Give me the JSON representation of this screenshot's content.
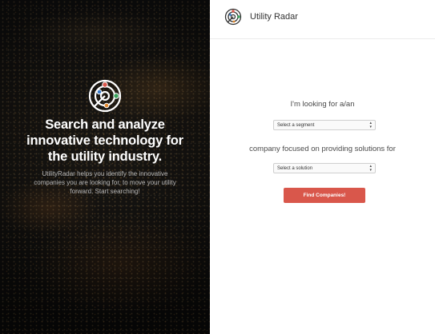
{
  "brand": {
    "name": "Utility Radar",
    "logo_icon": "radar-icon",
    "colors": {
      "red": "#d9574b",
      "green": "#3aa35c",
      "blue": "#3a7bc8",
      "orange": "#e38a2f"
    }
  },
  "hero": {
    "title": "Search and analyze innovative technology for the utility industry.",
    "subtitle": "UtilityRadar helps you identify the innovative companies you are looking for, to move your utility forward. Start searching!"
  },
  "form": {
    "segment_label": "I'm looking for a/an",
    "segment_select": {
      "selected": "Select a segment"
    },
    "solution_label": "company focused on providing solutions for",
    "solution_select": {
      "selected": "Select a solution"
    },
    "submit_label": "Find Companies!"
  },
  "theme": {
    "accent": "#d9574b",
    "text": "#4a4a4a",
    "border": "#cfcfcf"
  }
}
